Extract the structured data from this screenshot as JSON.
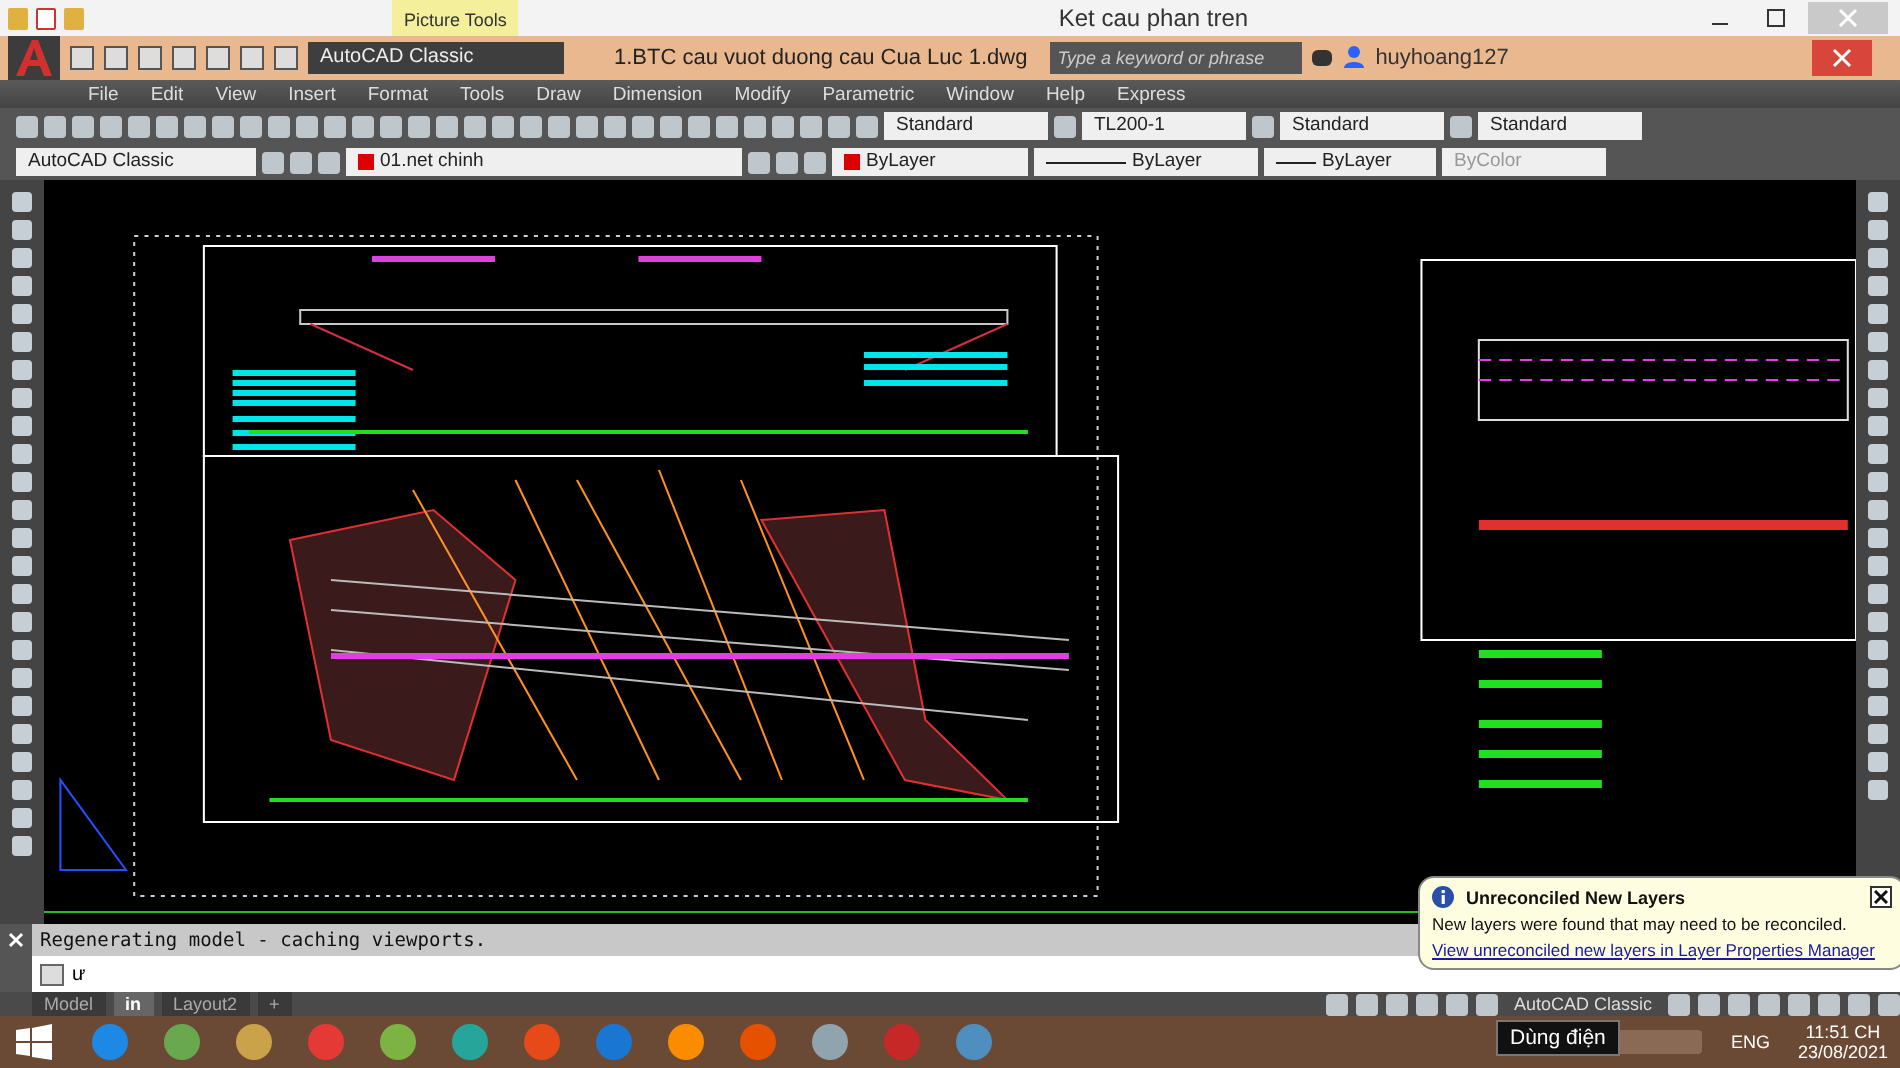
{
  "title_bar": {
    "tab": "Picture Tools",
    "title": "Ket cau phan tren"
  },
  "app_bar": {
    "workspace": "AutoCAD Classic",
    "file_title": "1.BTC cau vuot duong cau Cua Luc 1.dwg",
    "search_placeholder": "Type a keyword or phrase",
    "user": "huyhoang127"
  },
  "menu": [
    "File",
    "Edit",
    "View",
    "Insert",
    "Format",
    "Tools",
    "Draw",
    "Dimension",
    "Modify",
    "Parametric",
    "Window",
    "Help",
    "Express"
  ],
  "style_dropdowns": [
    "Standard",
    "TL200-1",
    "Standard",
    "Standard"
  ],
  "properties": {
    "workspace": "AutoCAD Classic",
    "layer": "01.net chinh",
    "color_control": "ByLayer",
    "linetype": "ByLayer",
    "lineweight": "ByLayer",
    "plot_style": {
      "label": "ByColor",
      "disabled": true
    }
  },
  "command": {
    "history": "Regenerating model - caching viewports.",
    "input": "ư"
  },
  "layout_tabs": [
    {
      "label": "Model",
      "selected": false
    },
    {
      "label": "in",
      "selected": true
    },
    {
      "label": "Layout2",
      "selected": false
    }
  ],
  "add_tab": "+",
  "status_workspace": "AutoCAD Classic",
  "notification": {
    "title": "Unreconciled New Layers",
    "message": "New layers were found that may need to be reconciled.",
    "link": "View unreconciled new layers in Layer Properties Manager"
  },
  "taskbar": {
    "tooltip": "Dùng điện",
    "language": "ENG",
    "time": "11:51 CH",
    "date": "23/08/2021"
  }
}
